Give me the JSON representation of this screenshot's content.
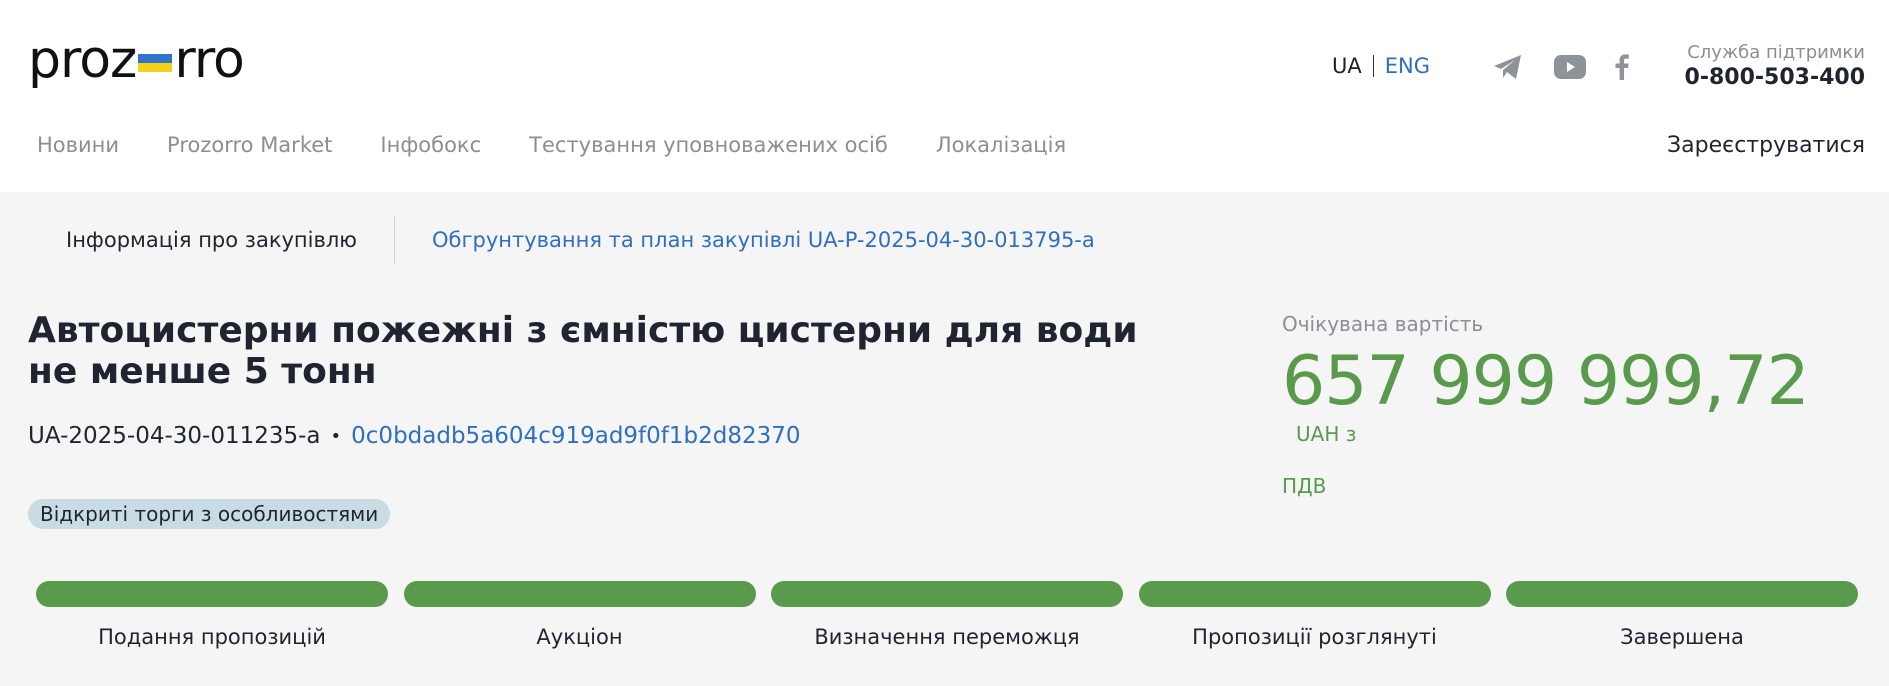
{
  "header": {
    "logo": {
      "text_left": "proz",
      "text_right": "rro",
      "flag_colors": [
        "#2f74c8",
        "#f5d21a"
      ]
    },
    "lang": {
      "ua": "UA",
      "eng": "ENG"
    },
    "social": [
      {
        "icon": "telegram-icon"
      },
      {
        "icon": "youtube-icon"
      },
      {
        "icon": "facebook-icon"
      }
    ],
    "support": {
      "label": "Служба підтримки",
      "phone": "0-800-503-400"
    },
    "nav": [
      {
        "label": "Новини"
      },
      {
        "label": "Prozorro Market"
      },
      {
        "label": "Інфобокс"
      },
      {
        "label": "Тестування уповноважених осіб"
      },
      {
        "label": "Локалізація"
      }
    ],
    "register_label": "Зареєструватися"
  },
  "tabs": {
    "info": "Інформація про закупівлю",
    "plan": "Обгрунтування та план закупівлі UA-P-2025-04-30-013795-a"
  },
  "tender": {
    "title": "Автоцистерни пожежні з ємністю цистерни для води не менше 5 тонн",
    "id": "UA-2025-04-30-011235-a",
    "separator": "•",
    "hash": "0c0bdadb5a604c919ad9f0f1b2d82370",
    "procedure": "Відкриті торги з особливостями"
  },
  "price": {
    "label": "Очікувана вартість",
    "amount": "657 999 999,72",
    "currency": "UAH з",
    "vat": "ПДВ"
  },
  "steps": [
    {
      "label": "Подання пропозицій"
    },
    {
      "label": "Аукціон"
    },
    {
      "label": "Визначення переможця"
    },
    {
      "label": "Пропозиції розглянуті"
    },
    {
      "label": "Завершена"
    }
  ],
  "colors": {
    "accent_blue": "#2f6fbd",
    "accent_green": "#5a9a4c",
    "muted_text": "#8a8f96",
    "badge_bg": "#c9dce3"
  }
}
